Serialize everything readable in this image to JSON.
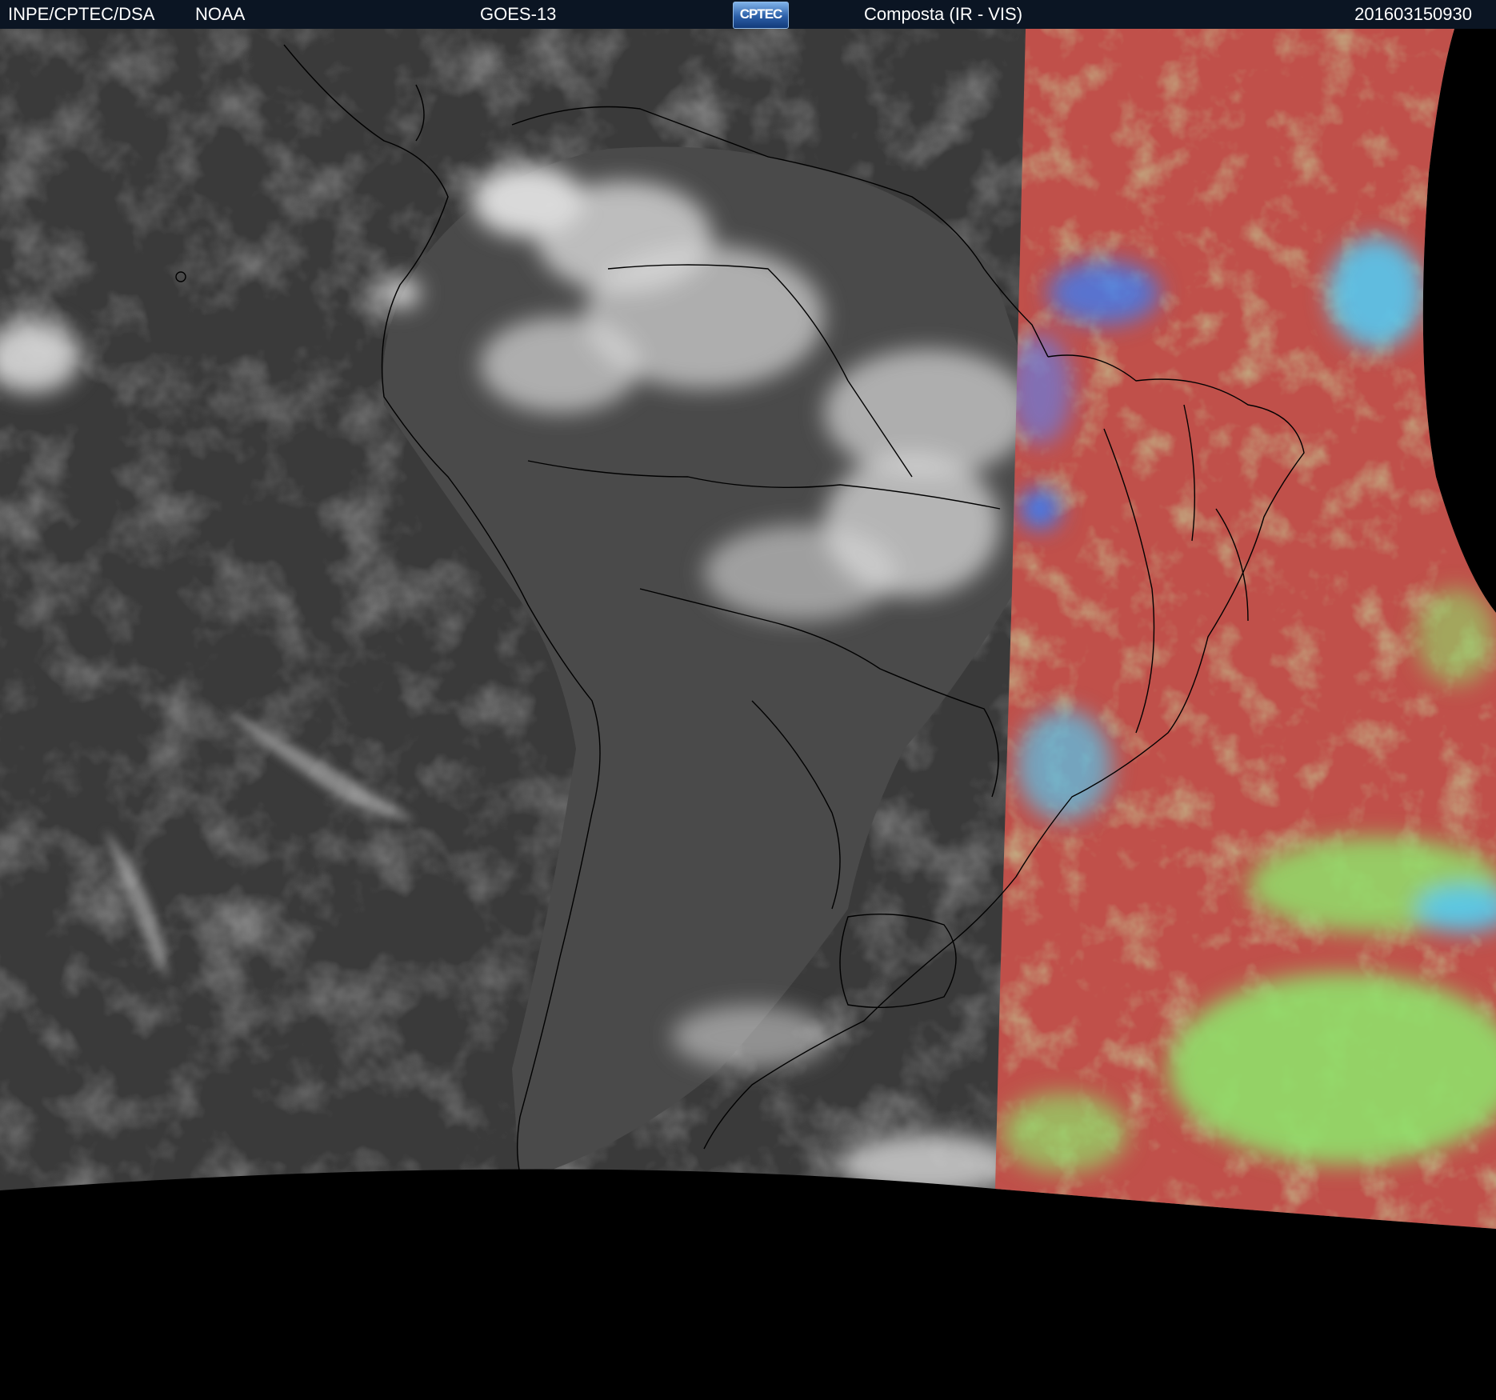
{
  "header": {
    "organization": "INPE/CPTEC/DSA",
    "agency": "NOAA",
    "satellite": "GOES-13",
    "logo_text": "CPTEC",
    "product": "Composta (IR - VIS)",
    "timestamp": "201603150930"
  },
  "colors": {
    "header_bg": "#0b1523",
    "background": "#000000",
    "ir_base": "#3a3a3a",
    "ir_cloud": "#d9d9d9",
    "vis_land": "#c0504a",
    "vis_low_cloud": "#8fe06a",
    "vis_high_cloud": "#55c8f0",
    "vis_deep_cloud": "#3d7cf0",
    "border_lines": "#000000"
  }
}
